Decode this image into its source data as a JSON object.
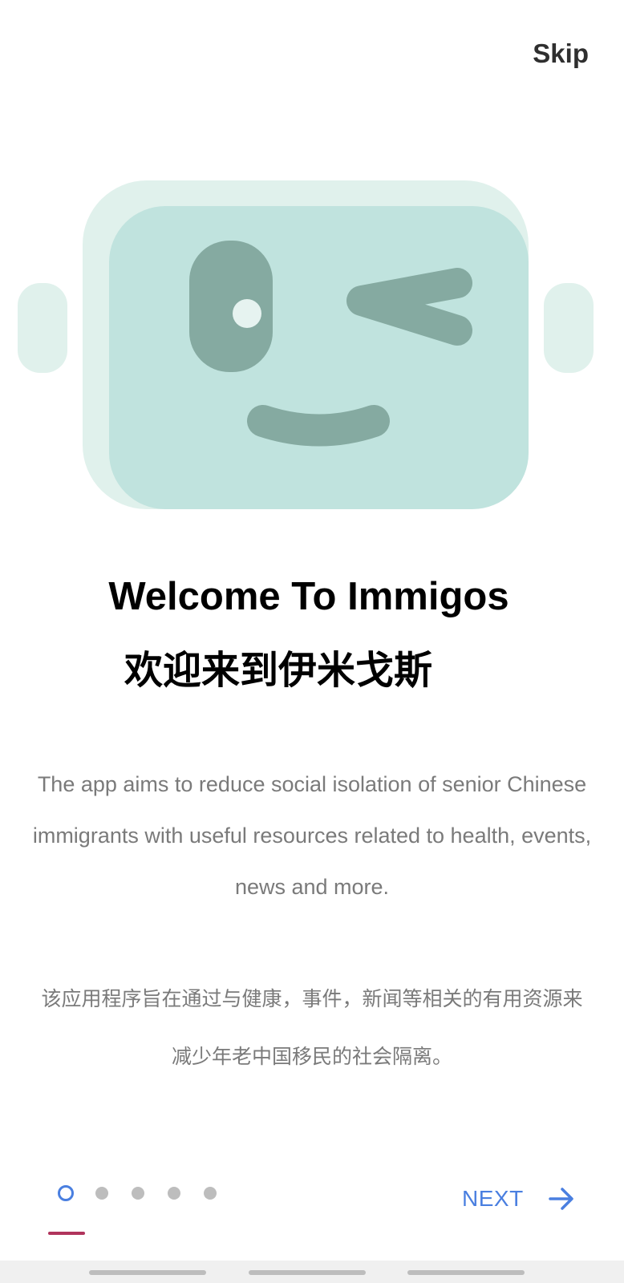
{
  "header": {
    "skip_label": "Skip"
  },
  "onboarding": {
    "title_en": "Welcome To Immigos",
    "title_zh": "欢迎来到伊米戈斯",
    "description_en": "The app aims to reduce social isolation of senior Chinese immigrants with useful resources related to health, events, news and more.",
    "description_zh": "该应用程序旨在通过与健康，事件，新闻等相关的有用资源来减少年老中国移民的社会隔离。",
    "page_count": 5,
    "current_page": 1
  },
  "footer": {
    "next_label": "NEXT"
  },
  "colors": {
    "accent": "#4a7fe0",
    "indicator_underline": "#b0345c",
    "robot_face": "#c0e3de",
    "robot_back": "#e0f1ec",
    "robot_features": "#85aaa1"
  }
}
